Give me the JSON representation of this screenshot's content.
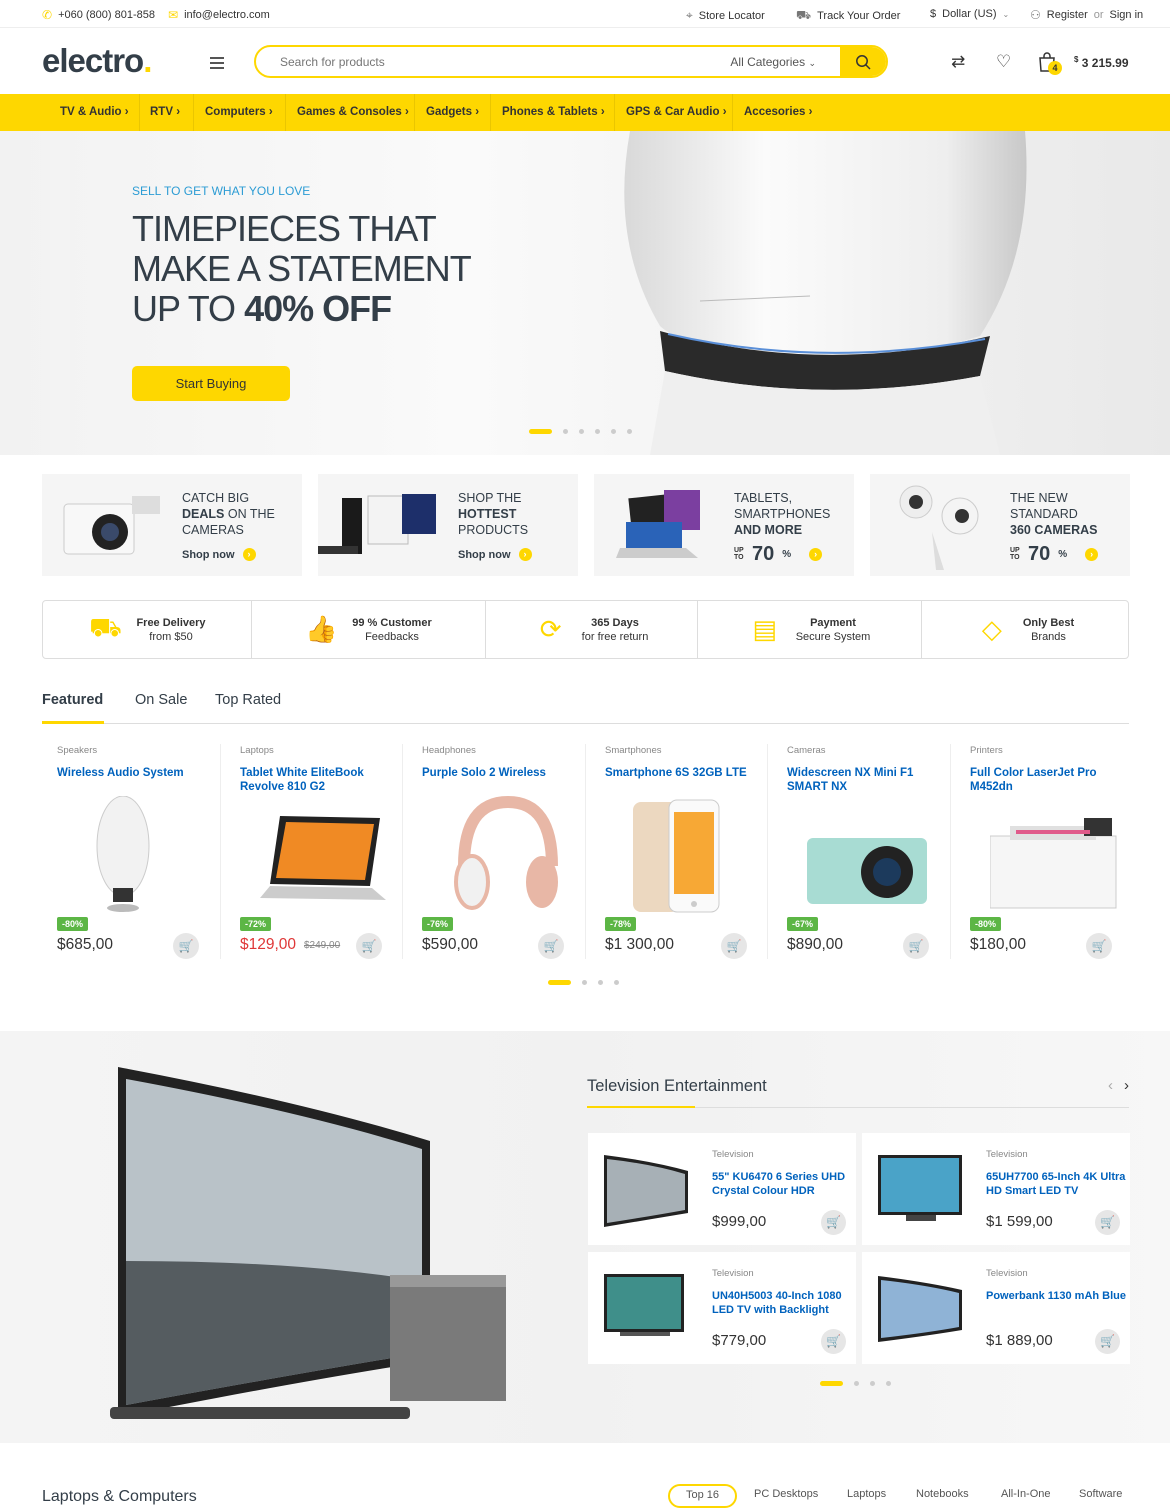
{
  "topbar": {
    "phone": "+060 (800) 801-858",
    "email": "info@electro.com",
    "store_locator": "Store Locator",
    "track_order": "Track Your Order",
    "currency": "Dollar (US)",
    "register": "Register",
    "or": "or",
    "signin": "Sign in"
  },
  "header": {
    "logo": "electro",
    "search_placeholder": "Search for products",
    "category_select": "All Categories",
    "cart_count": "4",
    "cart_total": "3 215.99",
    "cart_currency": "$"
  },
  "nav": [
    "TV & Audio",
    "RTV",
    "Computers",
    "Games & Consoles",
    "Gadgets",
    "Phones & Tablets",
    "GPS & Car Audio",
    "Accesories"
  ],
  "hero": {
    "kicker": "SELL TO GET WHAT YOU LOVE",
    "line1": "TIMEPIECES THAT",
    "line2": "MAKE A STATEMENT",
    "line3_pre": "UP TO ",
    "line3_bold": "40% OFF",
    "cta": "Start Buying"
  },
  "promos": [
    {
      "l1": "CATCH BIG",
      "b": "DEALS",
      "l2": " ON THE",
      "l3": "CAMERAS",
      "action": "Shop now"
    },
    {
      "l1": "SHOP THE",
      "b": "HOTTEST",
      "l2": "",
      "l3": "PRODUCTS",
      "action": "Shop now"
    },
    {
      "l1": "TABLETS,",
      "l2": "SMARTPHONES",
      "b": "AND MORE",
      "up": "UP TO",
      "pct": "70",
      "pctsign": "%"
    },
    {
      "l1": "THE NEW",
      "l2": "STANDARD",
      "b": "360 CAMERAS",
      "up": "UP TO",
      "pct": "70",
      "pctsign": "%"
    }
  ],
  "features": [
    {
      "title": "Free Delivery",
      "sub": "from $50",
      "icon": "truck-icon"
    },
    {
      "title": "99 % Customer",
      "sub": "Feedbacks",
      "icon": "thumbs-up-icon"
    },
    {
      "title": "365 Days",
      "sub": "for free return",
      "icon": "return-icon"
    },
    {
      "title": "Payment",
      "sub": "Secure System",
      "icon": "payment-icon"
    },
    {
      "title": "Only Best",
      "sub": "Brands",
      "icon": "tag-icon"
    }
  ],
  "tabs": [
    "Featured",
    "On Sale",
    "Top Rated"
  ],
  "products": [
    {
      "cat": "Speakers",
      "name": "Wireless Audio System",
      "disc": "-80%",
      "price": "$685,00",
      "old": ""
    },
    {
      "cat": "Laptops",
      "name": "Tablet White EliteBook Revolve 810 G2",
      "disc": "-72%",
      "price": "$129,00",
      "old": "$249,00"
    },
    {
      "cat": "Headphones",
      "name": "Purple Solo 2 Wireless",
      "disc": "-76%",
      "price": "$590,00",
      "old": ""
    },
    {
      "cat": "Smartphones",
      "name": "Smartphone 6S 32GB LTE",
      "disc": "-78%",
      "price": "$1 300,00",
      "old": ""
    },
    {
      "cat": "Cameras",
      "name": "Widescreen NX Mini F1 SMART NX",
      "disc": "-67%",
      "price": "$890,00",
      "old": ""
    },
    {
      "cat": "Printers",
      "name": "Full Color LaserJet Pro M452dn",
      "disc": "-80%",
      "price": "$180,00",
      "old": ""
    }
  ],
  "tv": {
    "title": "Television Entertainment",
    "items": [
      {
        "cat": "Television",
        "name": "55\" KU6470 6 Series UHD Crystal Colour HDR",
        "price": "$999,00"
      },
      {
        "cat": "Television",
        "name": "65UH7700 65-Inch 4K Ultra HD Smart LED TV",
        "price": "$1 599,00"
      },
      {
        "cat": "Television",
        "name": "UN40H5003 40-Inch 1080 LED TV with Backlight",
        "price": "$779,00"
      },
      {
        "cat": "Television",
        "name": "Powerbank 1130 mAh Blue",
        "price": "$1 889,00"
      }
    ]
  },
  "bottom": {
    "title": "Laptops & Computers",
    "tabs": [
      "Top 16",
      "PC Desktops",
      "Laptops",
      "Notebooks",
      "All-In-One",
      "Software"
    ]
  },
  "colors": {
    "accent": "#fed700",
    "link": "#0062bd",
    "sale": "#df3737",
    "discount": "#5cb645"
  }
}
